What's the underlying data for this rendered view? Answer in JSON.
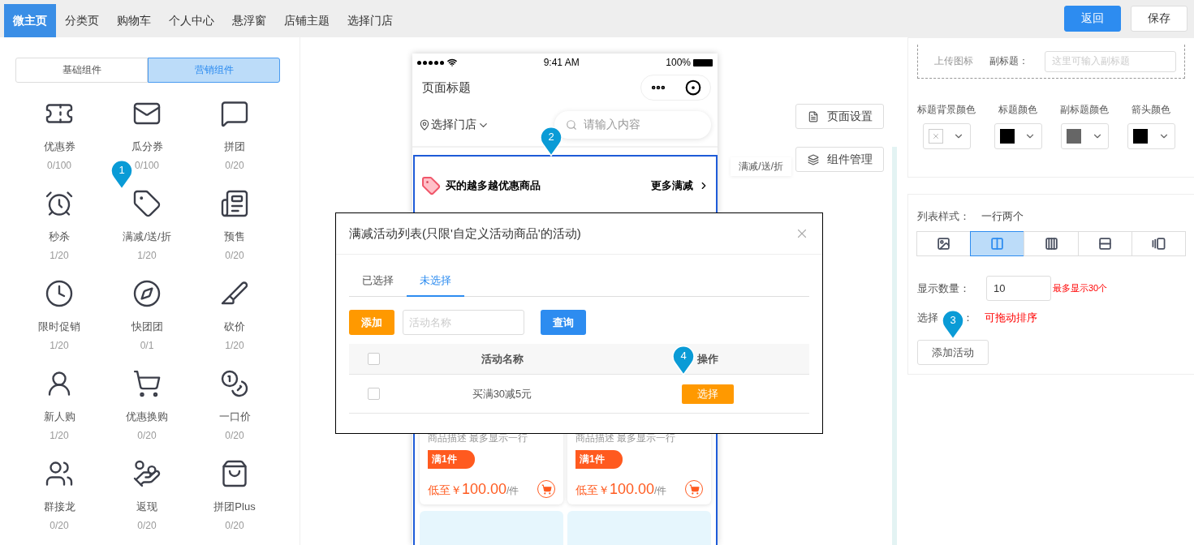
{
  "top_bar": {
    "tabs": [
      {
        "label": "微主页",
        "selected": true
      },
      {
        "label": "分类页",
        "selected": false
      },
      {
        "label": "购物车",
        "selected": false
      },
      {
        "label": "个人中心",
        "selected": false
      },
      {
        "label": "悬浮窗",
        "selected": false
      },
      {
        "label": "店铺主题",
        "selected": false
      },
      {
        "label": "选择门店",
        "selected": false
      }
    ],
    "buttons": [
      {
        "label": "返回",
        "kind": "primary"
      },
      {
        "label": "保存",
        "kind": "default"
      }
    ]
  },
  "component_panel": {
    "tabs": [
      {
        "label": "基础组件",
        "selected": false
      },
      {
        "label": "营销组件",
        "selected": true
      }
    ],
    "items": [
      {
        "label": "优惠券",
        "count": "0/100"
      },
      {
        "label": "瓜分券",
        "count": "0/100"
      },
      {
        "label": "拼团",
        "count": "0/20"
      },
      {
        "label": "秒杀",
        "count": "1/20"
      },
      {
        "label": "满减/送/折",
        "count": "1/20"
      },
      {
        "label": "预售",
        "count": "0/20"
      },
      {
        "label": "限时促销",
        "count": "1/20"
      },
      {
        "label": "快团团",
        "count": "0/1"
      },
      {
        "label": "砍价",
        "count": "1/20"
      },
      {
        "label": "新人购",
        "count": "1/20"
      },
      {
        "label": "优惠换购",
        "count": "0/20"
      },
      {
        "label": "一口价",
        "count": "0/20"
      },
      {
        "label": "群接龙",
        "count": "0/20"
      },
      {
        "label": "返现",
        "count": "0/20"
      },
      {
        "label": "拼团Plus",
        "count": "0/20"
      }
    ]
  },
  "phone": {
    "status_bar": {
      "time": "9:41 AM",
      "battery": "100%"
    },
    "title": "页面标题",
    "store_selector": "选择门店",
    "search_placeholder": "请输入内容",
    "section": {
      "title": "买的越多越优惠商品",
      "more": "更多满减"
    },
    "products": [
      {
        "description": "商品描述 最多显示一行",
        "tag": "满1件",
        "price_prefix": "低至￥",
        "price": "100.00",
        "unit": "/件"
      },
      {
        "description": "商品描述 最多显示一行",
        "tag": "满1件",
        "price_prefix": "低至￥",
        "price": "100.00",
        "unit": "/件"
      }
    ]
  },
  "side_buttons": [
    {
      "label": "页面设置"
    },
    {
      "label": "组件管理"
    }
  ],
  "component_tooltip": "满减/送/折",
  "settings": {
    "upload_label": "上传图标",
    "subtitle_label": "副标题：",
    "subtitle_placeholder": "这里可输入副标题",
    "colors": [
      {
        "label": "标题背景颜色"
      },
      {
        "label": "标题颜色",
        "color": "#000000"
      },
      {
        "label": "副标题颜色",
        "color": "#666666"
      },
      {
        "label": "箭头颜色",
        "color": "#000000"
      }
    ],
    "list_style": {
      "label": "列表样式：",
      "value": "一行两个",
      "options": [
        {
          "selected": false
        },
        {
          "selected": true
        },
        {
          "selected": false
        },
        {
          "selected": false
        },
        {
          "selected": false
        }
      ]
    },
    "display_count": {
      "label": "显示数量：",
      "value": "10",
      "hint": "最多显示30个"
    },
    "activities": {
      "label": "选择",
      "label_suffix": "：",
      "hint": "可拖动排序",
      "button": "添加活动"
    }
  },
  "modal": {
    "title": "满减活动列表(只限'自定义活动商品'的活动)",
    "tabs": [
      {
        "label": "已选择",
        "selected": false
      },
      {
        "label": "未选择",
        "selected": true
      }
    ],
    "add_button": "添加",
    "search_placeholder": "活动名称",
    "query_button": "查询",
    "header_checked": false,
    "columns": [
      "活动名称",
      "操作"
    ],
    "rows": [
      {
        "name": "买满30减5元",
        "checked": false,
        "action": "选择"
      }
    ]
  },
  "markers": [
    "1",
    "2",
    "3",
    "4"
  ]
}
